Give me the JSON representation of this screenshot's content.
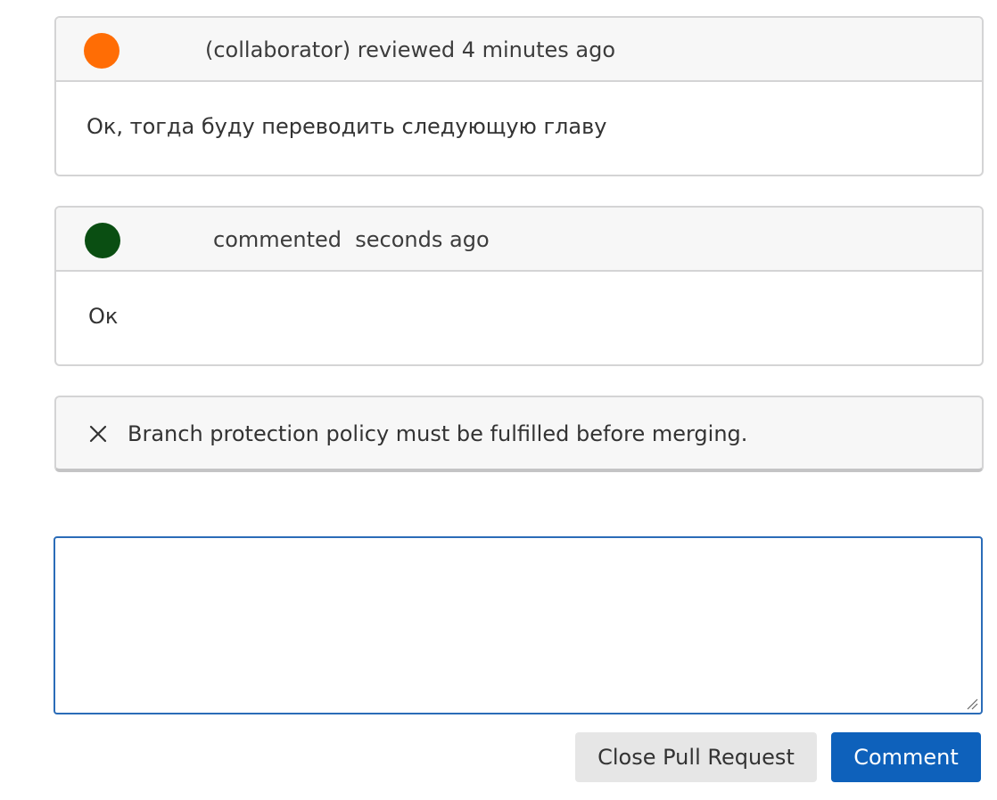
{
  "timeline": {
    "review": {
      "avatar_color": "#ff6d05",
      "header": "(collaborator) reviewed 4 minutes ago",
      "body": "Ок, тогда буду переводить следующую главу"
    },
    "comment": {
      "avatar_color": "#0a4e12",
      "header": "commented  seconds ago",
      "body": "Ок"
    }
  },
  "merge_status": {
    "icon": "close-icon",
    "message": "Branch protection policy must be fulfilled before merging."
  },
  "comment_form": {
    "value": "",
    "placeholder": ""
  },
  "actions": {
    "close_pr_label": "Close Pull Request",
    "comment_label": "Comment"
  }
}
